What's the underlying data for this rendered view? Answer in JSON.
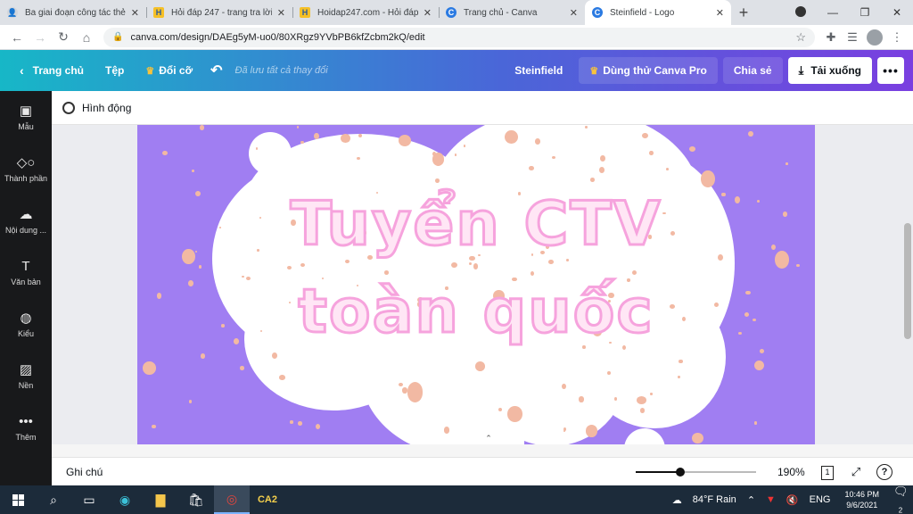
{
  "browser": {
    "tabs": [
      {
        "title": "Ba giai đoạn công tác thẻ",
        "favicon": "user-avatar-icon",
        "active": false
      },
      {
        "title": "Hỏi đáp 247 - trang tra lời",
        "favicon": "hoidap-icon",
        "active": false
      },
      {
        "title": "Hoidap247.com - Hỏi đáp",
        "favicon": "hoidap-icon",
        "active": false
      },
      {
        "title": "Trang chủ - Canva",
        "favicon": "canva-icon",
        "active": false
      },
      {
        "title": "Steinfield - Logo",
        "favicon": "canva-icon",
        "active": true
      }
    ],
    "url": "canva.com/design/DAEg5yM-uo0/80XRgz9YVbPB6kfZcbm2kQ/edit"
  },
  "header": {
    "home": "Trang chủ",
    "file": "Tệp",
    "resize": "Đổi cỡ",
    "saved": "Đã lưu tất cả thay đổi",
    "doc_title": "Steinfield",
    "try_pro": "Dùng thử Canva Pro",
    "share": "Chia sẻ",
    "download": "Tải xuống"
  },
  "sidebar": {
    "items": [
      {
        "label": "Mẫu",
        "icon": "template-icon"
      },
      {
        "label": "Thành phần",
        "icon": "elements-icon"
      },
      {
        "label": "Nội dung ...",
        "icon": "upload-icon"
      },
      {
        "label": "Văn bản",
        "icon": "text-icon"
      },
      {
        "label": "Kiểu",
        "icon": "palette-icon"
      },
      {
        "label": "Nền",
        "icon": "background-icon"
      },
      {
        "label": "Thêm",
        "icon": "more-icon"
      }
    ]
  },
  "toolbar": {
    "animate": "Hình động"
  },
  "canvas": {
    "line1": "Tuyển CTV",
    "line2": "toàn quốc",
    "bg_color": "#a07ef2",
    "text_fill": "#ffe6f5",
    "text_stroke": "#f6a3dd"
  },
  "footer": {
    "notes": "Ghi chú",
    "zoom": "190%",
    "zoom_level": 0.37,
    "page": "1"
  },
  "taskbar": {
    "app_label": "CA2",
    "weather": "84°F Rain",
    "lang": "ENG",
    "time": "10:46 PM",
    "date": "9/6/2021",
    "notifications": "2"
  }
}
